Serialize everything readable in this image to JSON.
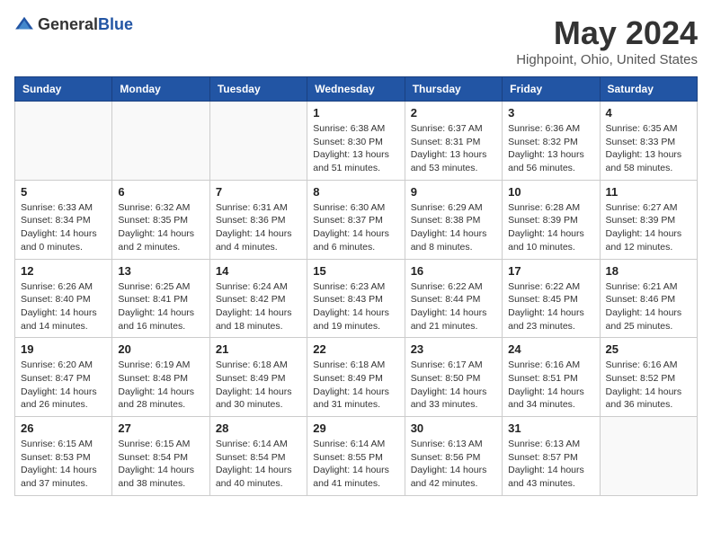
{
  "header": {
    "logo_general": "General",
    "logo_blue": "Blue",
    "month_title": "May 2024",
    "location": "Highpoint, Ohio, United States"
  },
  "weekdays": [
    "Sunday",
    "Monday",
    "Tuesday",
    "Wednesday",
    "Thursday",
    "Friday",
    "Saturday"
  ],
  "weeks": [
    [
      {
        "day": "",
        "info": ""
      },
      {
        "day": "",
        "info": ""
      },
      {
        "day": "",
        "info": ""
      },
      {
        "day": "1",
        "info": "Sunrise: 6:38 AM\nSunset: 8:30 PM\nDaylight: 13 hours\nand 51 minutes."
      },
      {
        "day": "2",
        "info": "Sunrise: 6:37 AM\nSunset: 8:31 PM\nDaylight: 13 hours\nand 53 minutes."
      },
      {
        "day": "3",
        "info": "Sunrise: 6:36 AM\nSunset: 8:32 PM\nDaylight: 13 hours\nand 56 minutes."
      },
      {
        "day": "4",
        "info": "Sunrise: 6:35 AM\nSunset: 8:33 PM\nDaylight: 13 hours\nand 58 minutes."
      }
    ],
    [
      {
        "day": "5",
        "info": "Sunrise: 6:33 AM\nSunset: 8:34 PM\nDaylight: 14 hours\nand 0 minutes."
      },
      {
        "day": "6",
        "info": "Sunrise: 6:32 AM\nSunset: 8:35 PM\nDaylight: 14 hours\nand 2 minutes."
      },
      {
        "day": "7",
        "info": "Sunrise: 6:31 AM\nSunset: 8:36 PM\nDaylight: 14 hours\nand 4 minutes."
      },
      {
        "day": "8",
        "info": "Sunrise: 6:30 AM\nSunset: 8:37 PM\nDaylight: 14 hours\nand 6 minutes."
      },
      {
        "day": "9",
        "info": "Sunrise: 6:29 AM\nSunset: 8:38 PM\nDaylight: 14 hours\nand 8 minutes."
      },
      {
        "day": "10",
        "info": "Sunrise: 6:28 AM\nSunset: 8:39 PM\nDaylight: 14 hours\nand 10 minutes."
      },
      {
        "day": "11",
        "info": "Sunrise: 6:27 AM\nSunset: 8:39 PM\nDaylight: 14 hours\nand 12 minutes."
      }
    ],
    [
      {
        "day": "12",
        "info": "Sunrise: 6:26 AM\nSunset: 8:40 PM\nDaylight: 14 hours\nand 14 minutes."
      },
      {
        "day": "13",
        "info": "Sunrise: 6:25 AM\nSunset: 8:41 PM\nDaylight: 14 hours\nand 16 minutes."
      },
      {
        "day": "14",
        "info": "Sunrise: 6:24 AM\nSunset: 8:42 PM\nDaylight: 14 hours\nand 18 minutes."
      },
      {
        "day": "15",
        "info": "Sunrise: 6:23 AM\nSunset: 8:43 PM\nDaylight: 14 hours\nand 19 minutes."
      },
      {
        "day": "16",
        "info": "Sunrise: 6:22 AM\nSunset: 8:44 PM\nDaylight: 14 hours\nand 21 minutes."
      },
      {
        "day": "17",
        "info": "Sunrise: 6:22 AM\nSunset: 8:45 PM\nDaylight: 14 hours\nand 23 minutes."
      },
      {
        "day": "18",
        "info": "Sunrise: 6:21 AM\nSunset: 8:46 PM\nDaylight: 14 hours\nand 25 minutes."
      }
    ],
    [
      {
        "day": "19",
        "info": "Sunrise: 6:20 AM\nSunset: 8:47 PM\nDaylight: 14 hours\nand 26 minutes."
      },
      {
        "day": "20",
        "info": "Sunrise: 6:19 AM\nSunset: 8:48 PM\nDaylight: 14 hours\nand 28 minutes."
      },
      {
        "day": "21",
        "info": "Sunrise: 6:18 AM\nSunset: 8:49 PM\nDaylight: 14 hours\nand 30 minutes."
      },
      {
        "day": "22",
        "info": "Sunrise: 6:18 AM\nSunset: 8:49 PM\nDaylight: 14 hours\nand 31 minutes."
      },
      {
        "day": "23",
        "info": "Sunrise: 6:17 AM\nSunset: 8:50 PM\nDaylight: 14 hours\nand 33 minutes."
      },
      {
        "day": "24",
        "info": "Sunrise: 6:16 AM\nSunset: 8:51 PM\nDaylight: 14 hours\nand 34 minutes."
      },
      {
        "day": "25",
        "info": "Sunrise: 6:16 AM\nSunset: 8:52 PM\nDaylight: 14 hours\nand 36 minutes."
      }
    ],
    [
      {
        "day": "26",
        "info": "Sunrise: 6:15 AM\nSunset: 8:53 PM\nDaylight: 14 hours\nand 37 minutes."
      },
      {
        "day": "27",
        "info": "Sunrise: 6:15 AM\nSunset: 8:54 PM\nDaylight: 14 hours\nand 38 minutes."
      },
      {
        "day": "28",
        "info": "Sunrise: 6:14 AM\nSunset: 8:54 PM\nDaylight: 14 hours\nand 40 minutes."
      },
      {
        "day": "29",
        "info": "Sunrise: 6:14 AM\nSunset: 8:55 PM\nDaylight: 14 hours\nand 41 minutes."
      },
      {
        "day": "30",
        "info": "Sunrise: 6:13 AM\nSunset: 8:56 PM\nDaylight: 14 hours\nand 42 minutes."
      },
      {
        "day": "31",
        "info": "Sunrise: 6:13 AM\nSunset: 8:57 PM\nDaylight: 14 hours\nand 43 minutes."
      },
      {
        "day": "",
        "info": ""
      }
    ]
  ]
}
